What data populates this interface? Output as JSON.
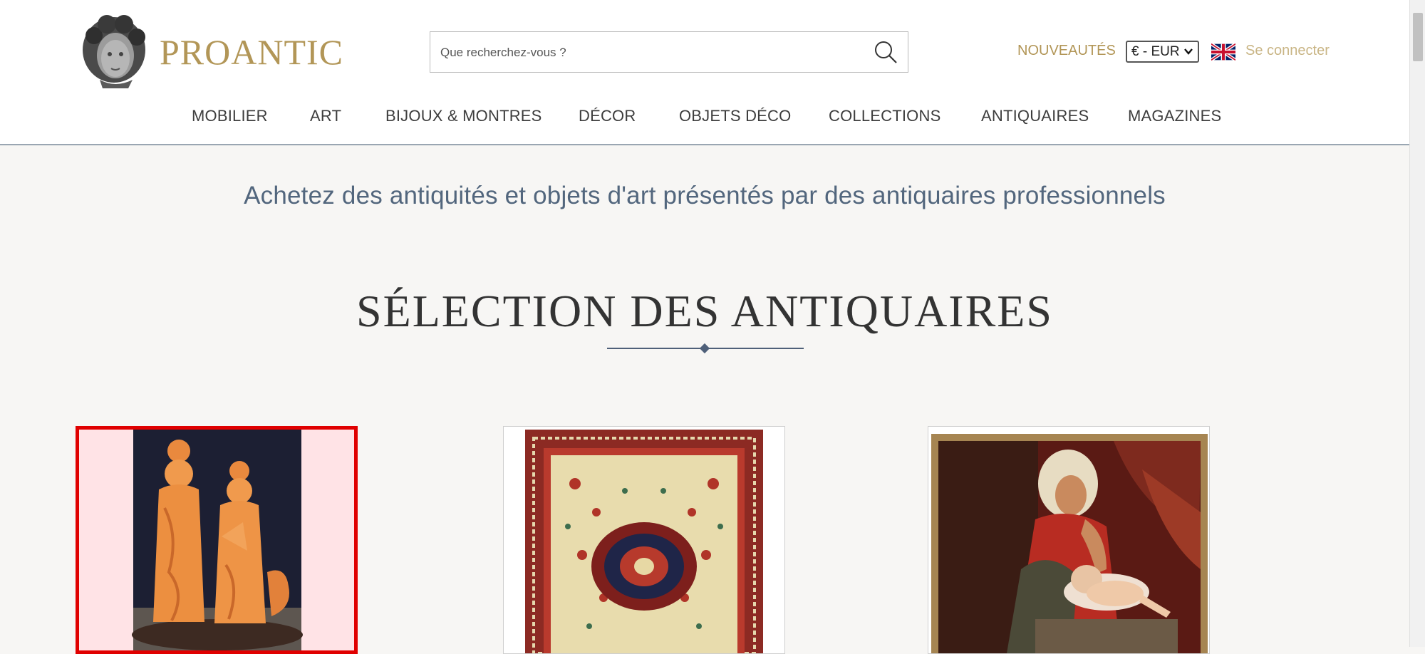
{
  "header": {
    "brand": "PROANTIC",
    "search": {
      "placeholder": "Que recherchez-vous ?"
    },
    "new_label": "NOUVEAUTÉS",
    "currency": "€ - EUR",
    "language_flag": "uk-flag-icon",
    "login_label": "Se connecter"
  },
  "nav": [
    "MOBILIER",
    "ART",
    "BIJOUX & MONTRES",
    "DÉCOR",
    "OBJETS DÉCO",
    "COLLECTIONS",
    "ANTIQUAIRES",
    "MAGAZINES"
  ],
  "main": {
    "tagline": "Achetez des antiquités et objets d'art présentés par des antiquaires professionnels",
    "section_title": "SÉLECTION DES ANTIQUAIRES",
    "cards": [
      {
        "image": "coral-figurines-image",
        "selected": true
      },
      {
        "image": "persian-rug-image",
        "selected": false
      },
      {
        "image": "mother-child-painting-image",
        "selected": false
      }
    ]
  },
  "colors": {
    "brand_gold": "#b29657",
    "tagline_blue": "#52667d",
    "selection_red": "#e00000",
    "page_bg": "#f7f6f4"
  }
}
